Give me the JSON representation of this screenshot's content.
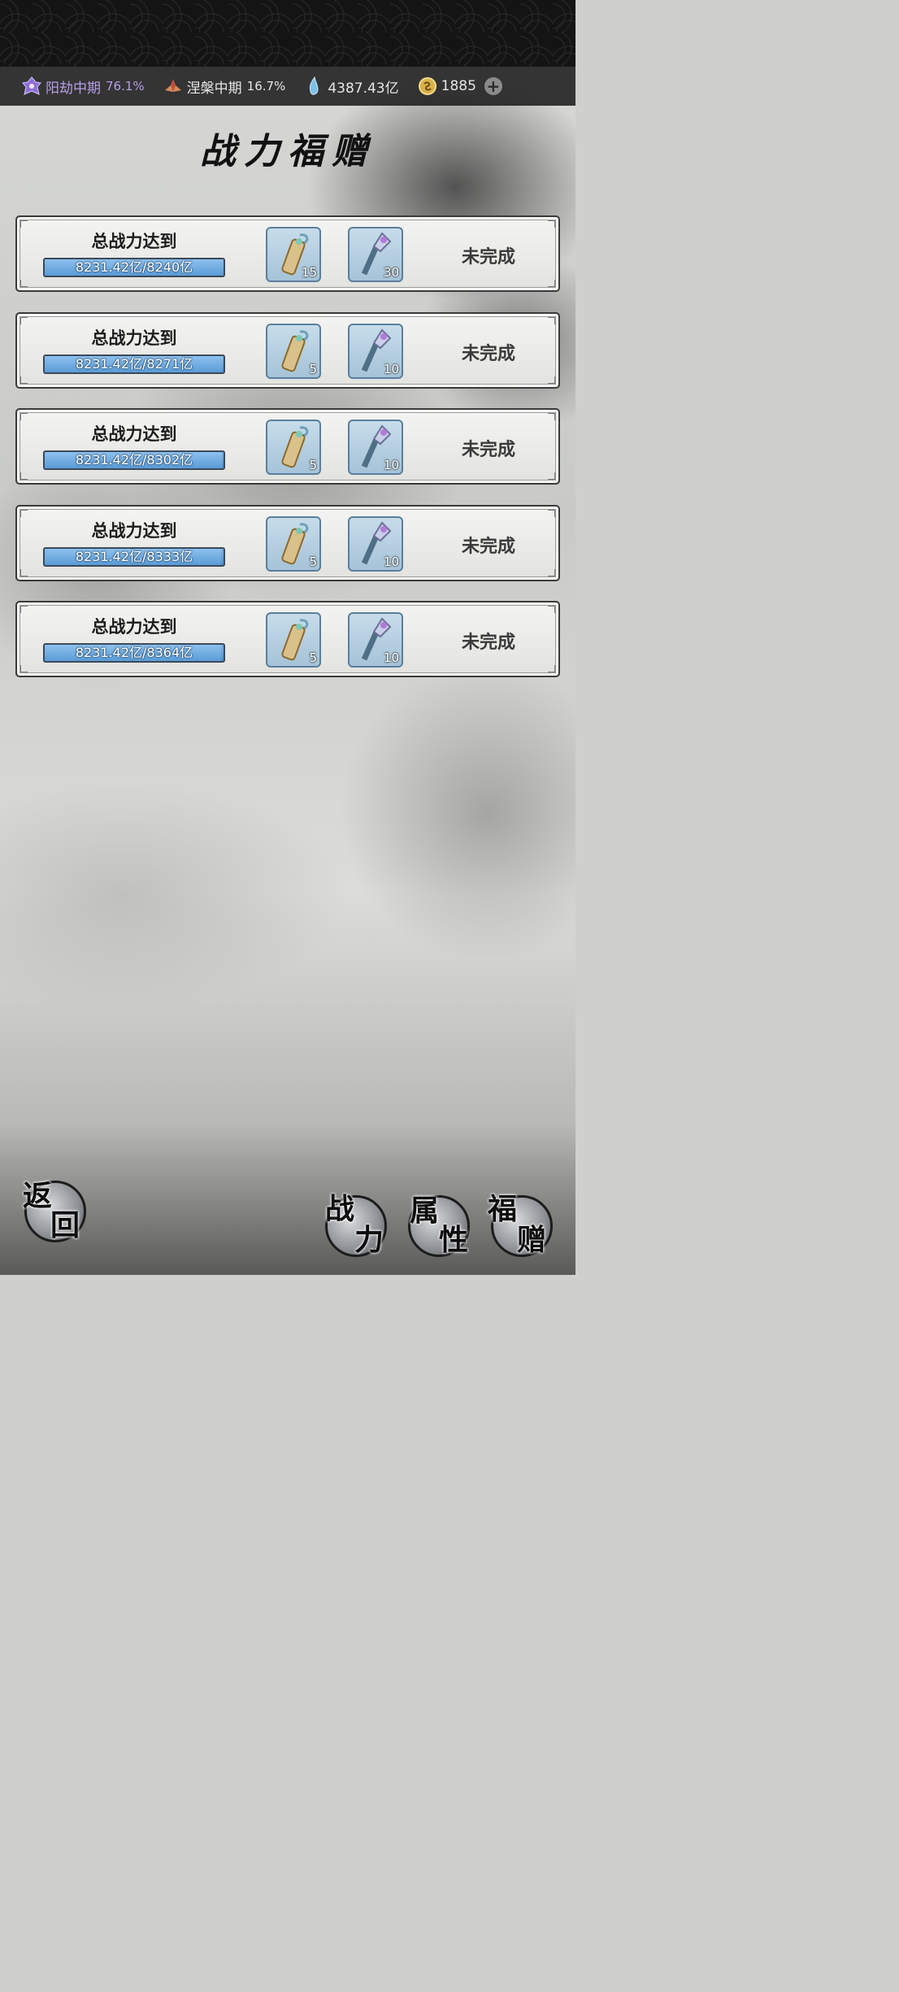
{
  "resources": [
    {
      "label": "阳劫中期",
      "percent": "76.1%",
      "icon": "purple-realm-icon"
    },
    {
      "label": "涅槃中期",
      "percent": "16.7%",
      "icon": "lotus-realm-icon"
    },
    {
      "label": "4387.43亿",
      "icon": "spirit-crystal-icon"
    },
    {
      "label": "1885",
      "icon": "gold-coin-icon"
    }
  ],
  "title": "战力福赠",
  "tasks": [
    {
      "label": "总战力达到",
      "progress_text": "8231.42亿/8240亿",
      "progress": 0.9989,
      "reward1_count": "15",
      "reward2_count": "30",
      "status": "未完成"
    },
    {
      "label": "总战力达到",
      "progress_text": "8231.42亿/8271亿",
      "progress": 0.9952,
      "reward1_count": "5",
      "reward2_count": "10",
      "status": "未完成"
    },
    {
      "label": "总战力达到",
      "progress_text": "8231.42亿/8302亿",
      "progress": 0.9915,
      "reward1_count": "5",
      "reward2_count": "10",
      "status": "未完成"
    },
    {
      "label": "总战力达到",
      "progress_text": "8231.42亿/8333亿",
      "progress": 0.9878,
      "reward1_count": "5",
      "reward2_count": "10",
      "status": "未完成"
    },
    {
      "label": "总战力达到",
      "progress_text": "8231.42亿/8364亿",
      "progress": 0.9841,
      "reward1_count": "5",
      "reward2_count": "10",
      "status": "未完成"
    }
  ],
  "nav": {
    "back_1": "返",
    "back_2": "回",
    "power_1": "战",
    "power_2": "力",
    "attr_1": "属",
    "attr_2": "性",
    "gift_1": "福",
    "gift_2": "赠"
  },
  "colors": {
    "progress_blue": "#5a9bd6",
    "realm_purple": "#b59ee8"
  }
}
